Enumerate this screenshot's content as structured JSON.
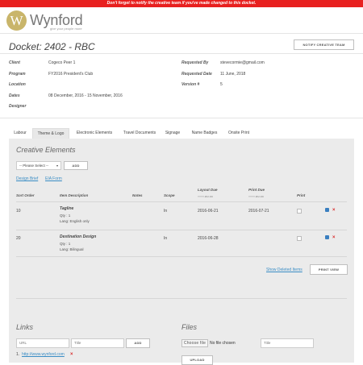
{
  "banner": {
    "text": "Don't forget to notify the creative team if you've made changed to this docket."
  },
  "logo": {
    "mark": "W",
    "name": "Wynford",
    "tagline": "give your people more"
  },
  "header": {
    "title": "Docket: 2402 - RBC",
    "notify_label": "NOTIFY CREATIVE TEAM"
  },
  "details": {
    "client_label": "Client",
    "client_value": "Cogeco Peer 1",
    "program_label": "Program",
    "program_value": "FY2016 President's Club",
    "location_label": "Location",
    "location_value": "",
    "dates_label": "Dates",
    "dates_value": "08 December, 2016 - 15 November, 2016",
    "designer_label": "Designer",
    "designer_value": "",
    "requested_by_label": "Requested By",
    "requested_by_value": "stevecormie@gmail.com",
    "requested_date_label": "Requested Date",
    "requested_date_value": "11 June, 2018",
    "version_label": "Version #",
    "version_value": "5"
  },
  "tabs": [
    "Labour",
    "Theme & Logo",
    "Electronic Elements",
    "Travel Documents",
    "Signage",
    "Name Badges",
    "Onsite Print"
  ],
  "active_tab": "Theme & Logo",
  "creative": {
    "title": "Creative Elements",
    "select_value": "-- Please Select --",
    "add_label": "ADD",
    "design_brief": "Design Brief",
    "eia_form": "EIA Form"
  },
  "table": {
    "headers": {
      "sort": "Sort Order",
      "item": "Item Description",
      "notes": "Notes",
      "scope": "Scope",
      "layout_due": "Layout Due",
      "layout_fmt": "YYYY-MM-DD",
      "print_due": "Print Due",
      "print_fmt": "YYYY-MM-DD",
      "print": "Print"
    },
    "rows": [
      {
        "sort": "10",
        "name": "Tagline",
        "qty": "Qty : 1",
        "lang": "Lang: English only",
        "scope": "In",
        "layout_due": "2016-06-21",
        "print_due": "2016-07-21"
      },
      {
        "sort": "20",
        "name": "Destination Design",
        "qty": "Qty : 1",
        "lang": "Lang: Bilingual",
        "scope": "In",
        "layout_due": "2016-06-28",
        "print_due": ""
      }
    ],
    "show_deleted": "Show Deleted Items",
    "print_view": "PRINT VIEW"
  },
  "links": {
    "title": "Links",
    "url_placeholder": "URL",
    "title_placeholder": "Title",
    "add_label": "ADD",
    "items": [
      {
        "number": "1.",
        "url": "http://www.wynford.com"
      }
    ]
  },
  "files": {
    "title": "Files",
    "choose_label": "Choose file",
    "no_file": "No file chosen",
    "title_placeholder": "Title",
    "upload_label": "UPLOAD"
  },
  "colors": {
    "banner": "#e8201f",
    "link": "#3a8dc5",
    "delete": "#d92b2b",
    "logo": "#c9b56a"
  },
  "icons": {
    "edit": "edit-icon",
    "delete": "delete-icon"
  }
}
